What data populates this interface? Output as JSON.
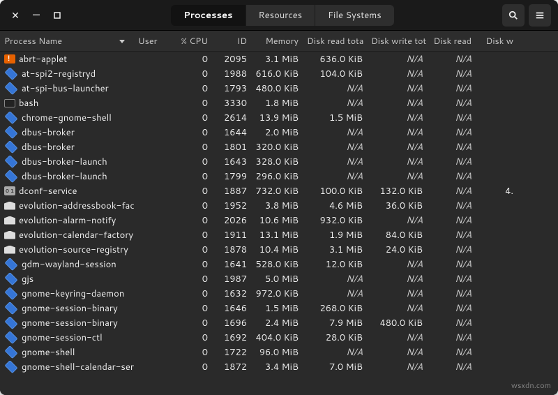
{
  "tabs": {
    "processes": "Processes",
    "resources": "Resources",
    "filesystems": "File Systems"
  },
  "columns": {
    "name": "Process Name",
    "user": "User",
    "cpu": "% CPU",
    "id": "ID",
    "mem": "Memory",
    "drt": "Disk read tota",
    "dwt": "Disk write tot",
    "dr": "Disk read",
    "dw": "Disk w"
  },
  "na": "N/A",
  "watermark": "wsxdn.com",
  "processes": [
    {
      "icon": "orange",
      "name": "abrt-applet",
      "cpu": "0",
      "id": "2095",
      "mem": "3.1 MiB",
      "drt": "636.0 KiB",
      "dwt": "N/A",
      "dr": "N/A",
      "dw": ""
    },
    {
      "icon": "diamond",
      "name": "at-spi2-registryd",
      "cpu": "0",
      "id": "1988",
      "mem": "616.0 KiB",
      "drt": "104.0 KiB",
      "dwt": "N/A",
      "dr": "N/A",
      "dw": ""
    },
    {
      "icon": "diamond",
      "name": "at-spi-bus-launcher",
      "cpu": "0",
      "id": "1793",
      "mem": "480.0 KiB",
      "drt": "N/A",
      "dwt": "N/A",
      "dr": "N/A",
      "dw": ""
    },
    {
      "icon": "term",
      "name": "bash",
      "cpu": "0",
      "id": "3330",
      "mem": "1.8 MiB",
      "drt": "N/A",
      "dwt": "N/A",
      "dr": "N/A",
      "dw": ""
    },
    {
      "icon": "diamond",
      "name": "chrome-gnome-shell",
      "cpu": "0",
      "id": "2614",
      "mem": "13.9 MiB",
      "drt": "1.5 MiB",
      "dwt": "N/A",
      "dr": "N/A",
      "dw": ""
    },
    {
      "icon": "diamond",
      "name": "dbus-broker",
      "cpu": "0",
      "id": "1644",
      "mem": "2.0 MiB",
      "drt": "N/A",
      "dwt": "N/A",
      "dr": "N/A",
      "dw": ""
    },
    {
      "icon": "diamond",
      "name": "dbus-broker",
      "cpu": "0",
      "id": "1801",
      "mem": "320.0 KiB",
      "drt": "N/A",
      "dwt": "N/A",
      "dr": "N/A",
      "dw": ""
    },
    {
      "icon": "diamond",
      "name": "dbus-broker-launch",
      "cpu": "0",
      "id": "1643",
      "mem": "328.0 KiB",
      "drt": "N/A",
      "dwt": "N/A",
      "dr": "N/A",
      "dw": ""
    },
    {
      "icon": "diamond",
      "name": "dbus-broker-launch",
      "cpu": "0",
      "id": "1799",
      "mem": "296.0 KiB",
      "drt": "N/A",
      "dwt": "N/A",
      "dr": "N/A",
      "dw": ""
    },
    {
      "icon": "dconf",
      "name": "dconf-service",
      "cpu": "0",
      "id": "1887",
      "mem": "732.0 KiB",
      "drt": "100.0 KiB",
      "dwt": "132.0 KiB",
      "dr": "N/A",
      "dw": "4."
    },
    {
      "icon": "env",
      "name": "evolution-addressbook-factory",
      "cpu": "0",
      "id": "1952",
      "mem": "3.8 MiB",
      "drt": "4.6 MiB",
      "dwt": "36.0 KiB",
      "dr": "N/A",
      "dw": ""
    },
    {
      "icon": "env",
      "name": "evolution-alarm-notify",
      "cpu": "0",
      "id": "2026",
      "mem": "10.6 MiB",
      "drt": "932.0 KiB",
      "dwt": "N/A",
      "dr": "N/A",
      "dw": ""
    },
    {
      "icon": "env",
      "name": "evolution-calendar-factory",
      "cpu": "0",
      "id": "1911",
      "mem": "13.1 MiB",
      "drt": "1.9 MiB",
      "dwt": "84.0 KiB",
      "dr": "N/A",
      "dw": ""
    },
    {
      "icon": "env",
      "name": "evolution-source-registry",
      "cpu": "0",
      "id": "1878",
      "mem": "10.4 MiB",
      "drt": "3.1 MiB",
      "dwt": "24.0 KiB",
      "dr": "N/A",
      "dw": ""
    },
    {
      "icon": "diamond",
      "name": "gdm-wayland-session",
      "cpu": "0",
      "id": "1641",
      "mem": "528.0 KiB",
      "drt": "12.0 KiB",
      "dwt": "N/A",
      "dr": "N/A",
      "dw": ""
    },
    {
      "icon": "diamond",
      "name": "gjs",
      "cpu": "0",
      "id": "1987",
      "mem": "5.0 MiB",
      "drt": "N/A",
      "dwt": "N/A",
      "dr": "N/A",
      "dw": ""
    },
    {
      "icon": "diamond",
      "name": "gnome-keyring-daemon",
      "cpu": "0",
      "id": "1632",
      "mem": "972.0 KiB",
      "drt": "N/A",
      "dwt": "N/A",
      "dr": "N/A",
      "dw": ""
    },
    {
      "icon": "diamond",
      "name": "gnome-session-binary",
      "cpu": "0",
      "id": "1646",
      "mem": "1.5 MiB",
      "drt": "268.0 KiB",
      "dwt": "N/A",
      "dr": "N/A",
      "dw": ""
    },
    {
      "icon": "diamond",
      "name": "gnome-session-binary",
      "cpu": "0",
      "id": "1696",
      "mem": "2.4 MiB",
      "drt": "7.9 MiB",
      "dwt": "480.0 KiB",
      "dr": "N/A",
      "dw": ""
    },
    {
      "icon": "diamond",
      "name": "gnome-session-ctl",
      "cpu": "0",
      "id": "1692",
      "mem": "404.0 KiB",
      "drt": "28.0 KiB",
      "dwt": "N/A",
      "dr": "N/A",
      "dw": ""
    },
    {
      "icon": "diamond",
      "name": "gnome-shell",
      "cpu": "0",
      "id": "1722",
      "mem": "96.0 MiB",
      "drt": "N/A",
      "dwt": "N/A",
      "dr": "N/A",
      "dw": ""
    },
    {
      "icon": "diamond",
      "name": "gnome-shell-calendar-server",
      "cpu": "0",
      "id": "1872",
      "mem": "3.4 MiB",
      "drt": "7.0 MiB",
      "dwt": "N/A",
      "dr": "N/A",
      "dw": ""
    }
  ]
}
